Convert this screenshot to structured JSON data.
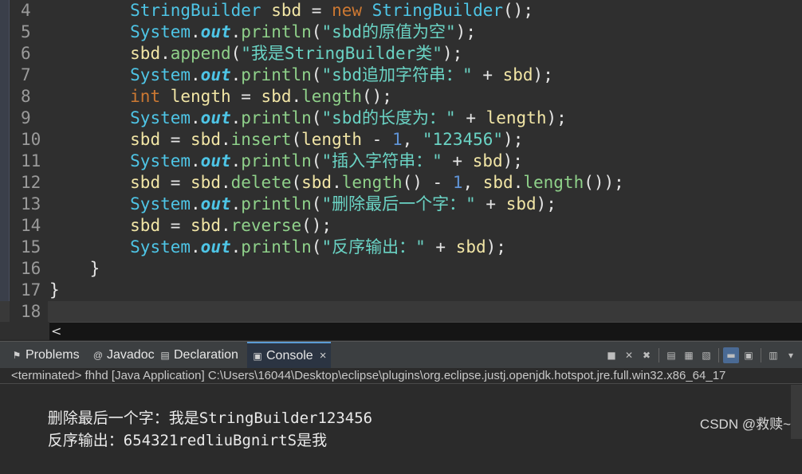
{
  "editor": {
    "line_numbers": [
      "4",
      "5",
      "6",
      "7",
      "8",
      "9",
      "10",
      "11",
      "12",
      "13",
      "14",
      "15",
      "16",
      "17",
      "18"
    ],
    "lines": [
      {
        "indent": "        ",
        "tokens": [
          {
            "t": "StringBuilder",
            "c": "t-type"
          },
          {
            "t": " ",
            "c": "t-op"
          },
          {
            "t": "sbd",
            "c": "t-var"
          },
          {
            "t": " = ",
            "c": "t-op"
          },
          {
            "t": "new",
            "c": "t-kw"
          },
          {
            "t": " ",
            "c": "t-op"
          },
          {
            "t": "StringBuilder",
            "c": "t-type"
          },
          {
            "t": "();",
            "c": "t-op"
          }
        ]
      },
      {
        "indent": "        ",
        "tokens": [
          {
            "t": "System",
            "c": "t-type"
          },
          {
            "t": ".",
            "c": "t-op"
          },
          {
            "t": "out",
            "c": "t-field"
          },
          {
            "t": ".",
            "c": "t-op"
          },
          {
            "t": "println",
            "c": "t-method"
          },
          {
            "t": "(",
            "c": "t-op"
          },
          {
            "t": "\"sbd的原值为空\"",
            "c": "t-str"
          },
          {
            "t": ");",
            "c": "t-op"
          }
        ]
      },
      {
        "indent": "        ",
        "tokens": [
          {
            "t": "sbd",
            "c": "t-var"
          },
          {
            "t": ".",
            "c": "t-op"
          },
          {
            "t": "append",
            "c": "t-method"
          },
          {
            "t": "(",
            "c": "t-op"
          },
          {
            "t": "\"我是StringBuilder类\"",
            "c": "t-str"
          },
          {
            "t": ");",
            "c": "t-op"
          }
        ]
      },
      {
        "indent": "        ",
        "tokens": [
          {
            "t": "System",
            "c": "t-type"
          },
          {
            "t": ".",
            "c": "t-op"
          },
          {
            "t": "out",
            "c": "t-field"
          },
          {
            "t": ".",
            "c": "t-op"
          },
          {
            "t": "println",
            "c": "t-method"
          },
          {
            "t": "(",
            "c": "t-op"
          },
          {
            "t": "\"sbd追加字符串：\"",
            "c": "t-str"
          },
          {
            "t": " + ",
            "c": "t-op"
          },
          {
            "t": "sbd",
            "c": "t-var"
          },
          {
            "t": ");",
            "c": "t-op"
          }
        ]
      },
      {
        "indent": "        ",
        "tokens": [
          {
            "t": "int",
            "c": "t-kw"
          },
          {
            "t": " ",
            "c": "t-op"
          },
          {
            "t": "length",
            "c": "t-var"
          },
          {
            "t": " = ",
            "c": "t-op"
          },
          {
            "t": "sbd",
            "c": "t-var"
          },
          {
            "t": ".",
            "c": "t-op"
          },
          {
            "t": "length",
            "c": "t-method"
          },
          {
            "t": "();",
            "c": "t-op"
          }
        ]
      },
      {
        "indent": "        ",
        "tokens": [
          {
            "t": "System",
            "c": "t-type"
          },
          {
            "t": ".",
            "c": "t-op"
          },
          {
            "t": "out",
            "c": "t-field"
          },
          {
            "t": ".",
            "c": "t-op"
          },
          {
            "t": "println",
            "c": "t-method"
          },
          {
            "t": "(",
            "c": "t-op"
          },
          {
            "t": "\"sbd的长度为：\"",
            "c": "t-str"
          },
          {
            "t": " + ",
            "c": "t-op"
          },
          {
            "t": "length",
            "c": "t-var"
          },
          {
            "t": ");",
            "c": "t-op"
          }
        ]
      },
      {
        "indent": "        ",
        "tokens": [
          {
            "t": "sbd",
            "c": "t-var"
          },
          {
            "t": " = ",
            "c": "t-op"
          },
          {
            "t": "sbd",
            "c": "t-var"
          },
          {
            "t": ".",
            "c": "t-op"
          },
          {
            "t": "insert",
            "c": "t-method"
          },
          {
            "t": "(",
            "c": "t-op"
          },
          {
            "t": "length",
            "c": "t-var"
          },
          {
            "t": " - ",
            "c": "t-op"
          },
          {
            "t": "1",
            "c": "t-num"
          },
          {
            "t": ", ",
            "c": "t-op"
          },
          {
            "t": "\"123456\"",
            "c": "t-str"
          },
          {
            "t": ");",
            "c": "t-op"
          }
        ]
      },
      {
        "indent": "        ",
        "tokens": [
          {
            "t": "System",
            "c": "t-type"
          },
          {
            "t": ".",
            "c": "t-op"
          },
          {
            "t": "out",
            "c": "t-field"
          },
          {
            "t": ".",
            "c": "t-op"
          },
          {
            "t": "println",
            "c": "t-method"
          },
          {
            "t": "(",
            "c": "t-op"
          },
          {
            "t": "\"插入字符串：\"",
            "c": "t-str"
          },
          {
            "t": " + ",
            "c": "t-op"
          },
          {
            "t": "sbd",
            "c": "t-var"
          },
          {
            "t": ");",
            "c": "t-op"
          }
        ]
      },
      {
        "indent": "        ",
        "tokens": [
          {
            "t": "sbd",
            "c": "t-var"
          },
          {
            "t": " = ",
            "c": "t-op"
          },
          {
            "t": "sbd",
            "c": "t-var"
          },
          {
            "t": ".",
            "c": "t-op"
          },
          {
            "t": "delete",
            "c": "t-method"
          },
          {
            "t": "(",
            "c": "t-op"
          },
          {
            "t": "sbd",
            "c": "t-var"
          },
          {
            "t": ".",
            "c": "t-op"
          },
          {
            "t": "length",
            "c": "t-method"
          },
          {
            "t": "() - ",
            "c": "t-op"
          },
          {
            "t": "1",
            "c": "t-num"
          },
          {
            "t": ", ",
            "c": "t-op"
          },
          {
            "t": "sbd",
            "c": "t-var"
          },
          {
            "t": ".",
            "c": "t-op"
          },
          {
            "t": "length",
            "c": "t-method"
          },
          {
            "t": "());",
            "c": "t-op"
          }
        ]
      },
      {
        "indent": "        ",
        "tokens": [
          {
            "t": "System",
            "c": "t-type"
          },
          {
            "t": ".",
            "c": "t-op"
          },
          {
            "t": "out",
            "c": "t-field"
          },
          {
            "t": ".",
            "c": "t-op"
          },
          {
            "t": "println",
            "c": "t-method"
          },
          {
            "t": "(",
            "c": "t-op"
          },
          {
            "t": "\"删除最后一个字：\"",
            "c": "t-str"
          },
          {
            "t": " + ",
            "c": "t-op"
          },
          {
            "t": "sbd",
            "c": "t-var"
          },
          {
            "t": ");",
            "c": "t-op"
          }
        ]
      },
      {
        "indent": "        ",
        "tokens": [
          {
            "t": "sbd",
            "c": "t-var"
          },
          {
            "t": " = ",
            "c": "t-op"
          },
          {
            "t": "sbd",
            "c": "t-var"
          },
          {
            "t": ".",
            "c": "t-op"
          },
          {
            "t": "reverse",
            "c": "t-method"
          },
          {
            "t": "();",
            "c": "t-op"
          }
        ]
      },
      {
        "indent": "        ",
        "tokens": [
          {
            "t": "System",
            "c": "t-type"
          },
          {
            "t": ".",
            "c": "t-op"
          },
          {
            "t": "out",
            "c": "t-field"
          },
          {
            "t": ".",
            "c": "t-op"
          },
          {
            "t": "println",
            "c": "t-method"
          },
          {
            "t": "(",
            "c": "t-op"
          },
          {
            "t": "\"反序输出：\"",
            "c": "t-str"
          },
          {
            "t": " + ",
            "c": "t-op"
          },
          {
            "t": "sbd",
            "c": "t-var"
          },
          {
            "t": ");",
            "c": "t-op"
          }
        ]
      },
      {
        "indent": "    ",
        "tokens": [
          {
            "t": "}",
            "c": "t-op"
          }
        ]
      },
      {
        "indent": "",
        "tokens": [
          {
            "t": "}",
            "c": "t-op"
          }
        ]
      },
      {
        "indent": "",
        "tokens": []
      }
    ],
    "hscroll_left": "<"
  },
  "views": {
    "tabs": [
      {
        "label": "Problems",
        "icon": "problems-icon",
        "glyph": "⚑"
      },
      {
        "label": "Javadoc",
        "icon": "javadoc-icon",
        "glyph": "@"
      },
      {
        "label": "Declaration",
        "icon": "declaration-icon",
        "glyph": "▤"
      },
      {
        "label": "Console",
        "icon": "console-icon",
        "glyph": "▣"
      }
    ],
    "active_tab": "Console",
    "close_glyph": "×"
  },
  "console": {
    "description": "<terminated> fhhd [Java Application] C:\\Users\\16044\\Desktop\\eclipse\\plugins\\org.eclipse.justj.openjdk.hotspot.jre.full.win32.x86_64_17",
    "output": [
      {
        "cjk": "删除最后一个字：我是",
        "rest": "StringBuilder123456"
      },
      {
        "cjk": "反序输出：",
        "rest": "654321redliuBgnirtS",
        "cjk2": "是我"
      }
    ]
  },
  "watermark": "CSDN @救赎~",
  "colors": {
    "accent": "#5b9bd5",
    "editor_bg": "#2f2f2f",
    "console_bg": "#2b2b2b"
  }
}
